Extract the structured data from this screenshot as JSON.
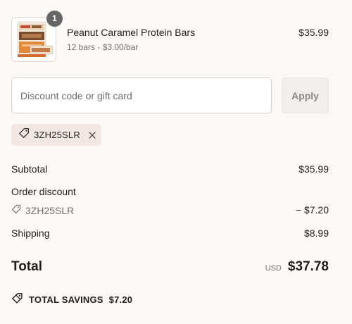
{
  "product": {
    "quantity": "1",
    "name": "Peanut Caramel Protein Bars",
    "meta": "12 bars - $3.00/bar",
    "price": "$35.99"
  },
  "discount": {
    "placeholder": "Discount code or gift card",
    "value": "",
    "apply_label": "Apply",
    "applied_code": "3ZH25SLR"
  },
  "totals": {
    "subtotal_label": "Subtotal",
    "subtotal_value": "$35.99",
    "order_discount_label": "Order discount",
    "discount_code": "3ZH25SLR",
    "discount_value": "− $7.20",
    "shipping_label": "Shipping",
    "shipping_value": "$8.99",
    "total_label": "Total",
    "currency": "USD",
    "total_value": "$37.78",
    "savings_label": "TOTAL SAVINGS",
    "savings_value": "$7.20"
  },
  "icons": {
    "tag": "tag-icon",
    "remove": "close-icon",
    "savings": "savings-tag-icon"
  },
  "colors": {
    "background": "#fdf8f5",
    "chip_background": "#f3e7e1",
    "badge": "#666666",
    "apply_button": "#f4eeea"
  }
}
